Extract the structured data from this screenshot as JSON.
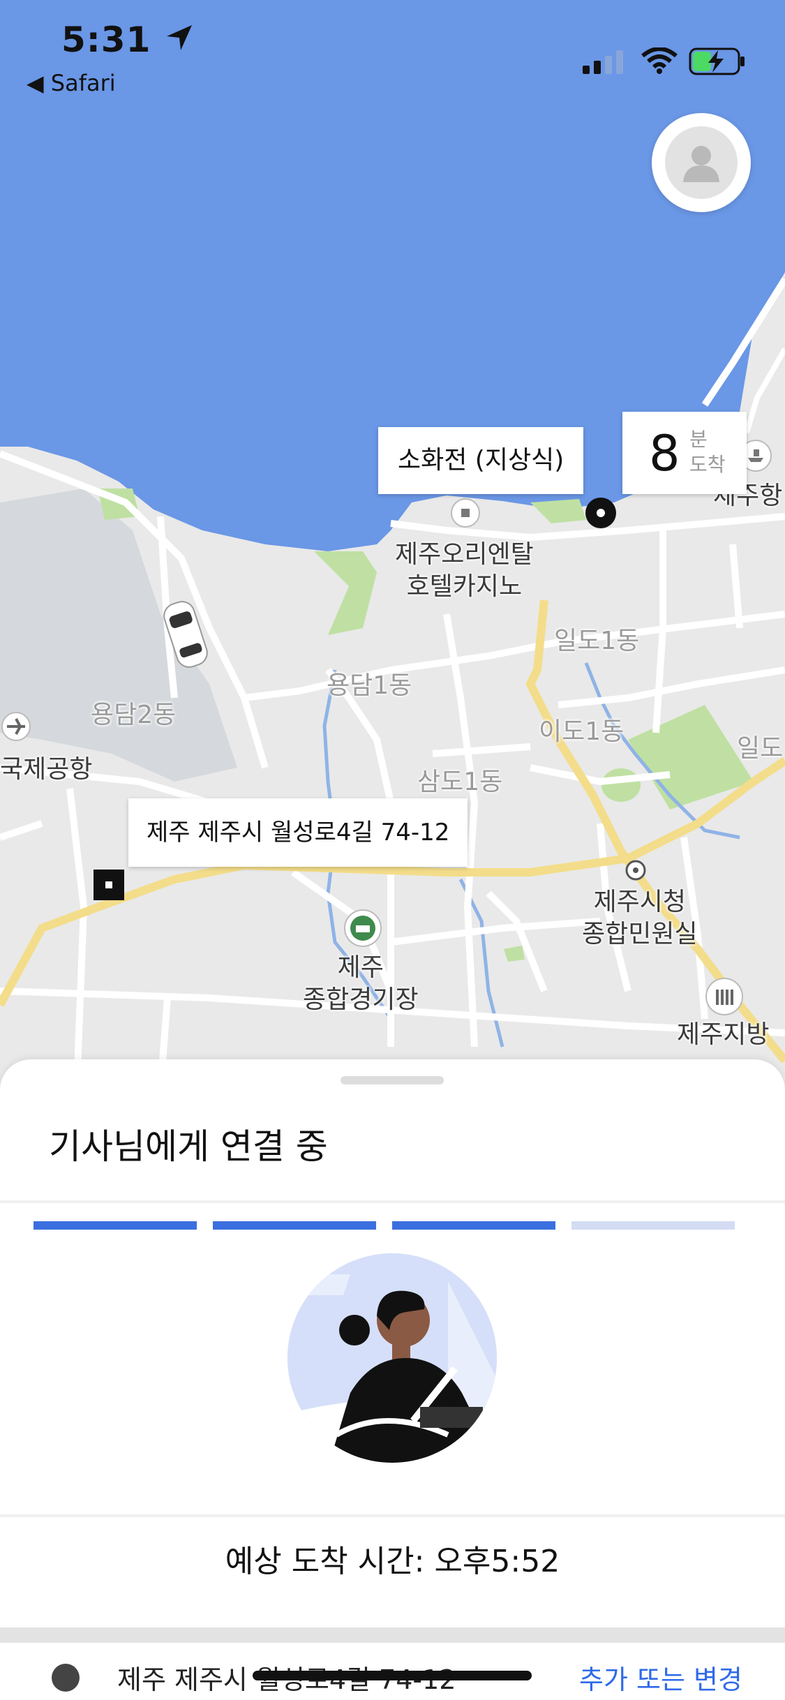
{
  "status_bar": {
    "time": "5:31",
    "back_app": "◀ Safari",
    "icons": [
      "location-arrow-icon",
      "signal-icon",
      "wifi-icon",
      "battery-charging-icon"
    ]
  },
  "map": {
    "pickup_label": "소화전 (지상식)",
    "eta_minutes": "8",
    "eta_unit": "분",
    "eta_unit2": "도착",
    "destination_label": "제주 제주시 월성로4길 74-12",
    "places": [
      {
        "text": "제주오리엔탈\n호텔카지노"
      },
      {
        "text": "일도1동"
      },
      {
        "text": "용담1동"
      },
      {
        "text": "용담2동"
      },
      {
        "text": "이도1동"
      },
      {
        "text": "삼도1동"
      },
      {
        "text": "국제공항"
      },
      {
        "text": "제주시청\n종합민원실"
      },
      {
        "text": "제주\n종합경기장"
      },
      {
        "text": "제주지방"
      },
      {
        "text": "제주항"
      },
      {
        "text": "일도"
      }
    ]
  },
  "sheet": {
    "title": "기사님에게 연결 중",
    "progress_steps": 4,
    "progress_completed": 3,
    "eta_text": "예상 도착 시간: 오후5:52",
    "address": "제주 제주시 월성로4길 74-12",
    "change_link": "추가 또는 변경"
  },
  "colors": {
    "sea": "#6a97e6",
    "land": "#e9e9e9",
    "park": "#bfe0a2",
    "major_road": "#f6e08e",
    "accent": "#3b6fe0",
    "progress_inactive": "#d3dcf2"
  }
}
